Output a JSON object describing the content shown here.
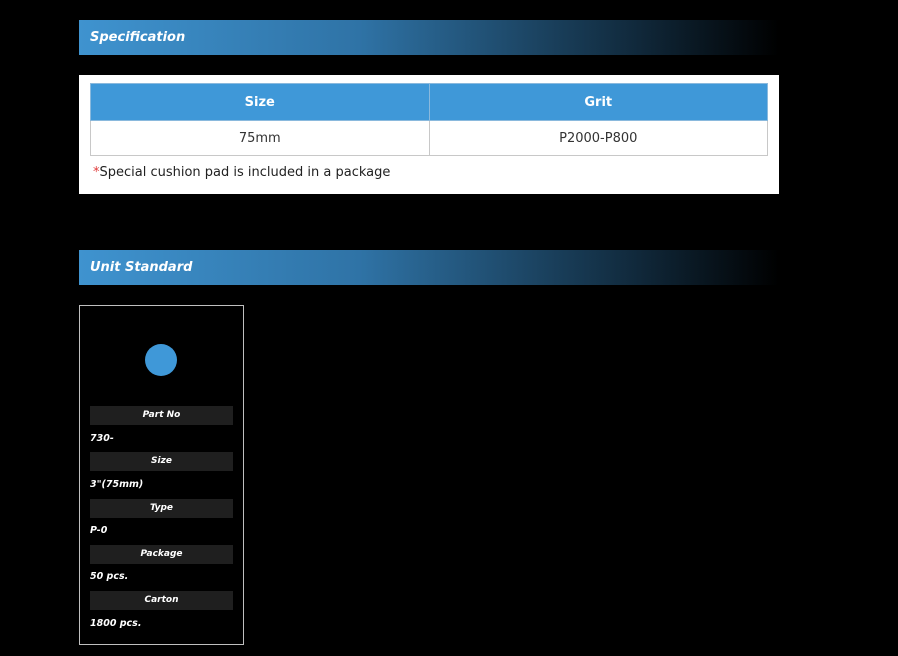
{
  "spec_section": {
    "title": "Specification",
    "table": {
      "headers": [
        "Size",
        "Grit"
      ],
      "rows": [
        [
          "75mm",
          "P2000-P800"
        ]
      ]
    },
    "note_star": "*",
    "note_text": "Special cushion pad is included in a package"
  },
  "unit_section": {
    "title": "Unit Standard",
    "circle_color": "#3f98d8",
    "fields": [
      {
        "label": "Part No",
        "value": "730-"
      },
      {
        "label": "Size",
        "value": "3\"(75mm)"
      },
      {
        "label": "Type",
        "value": "P-0"
      },
      {
        "label": "Package",
        "value": "50 pcs."
      },
      {
        "label": "Carton",
        "value": "1800 pcs."
      }
    ]
  }
}
